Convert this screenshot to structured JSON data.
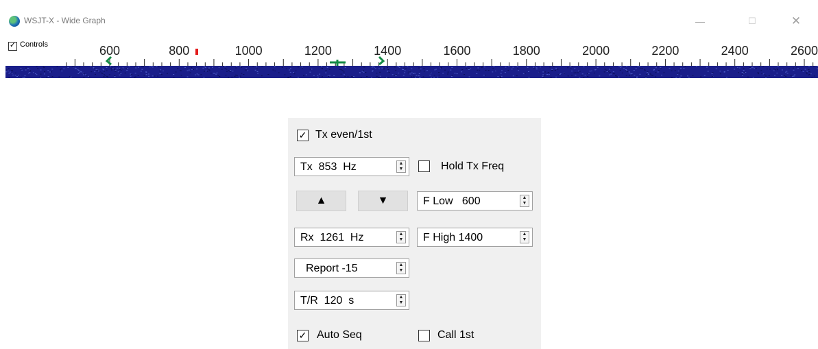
{
  "wide_graph": {
    "title": "WSJT-X - Wide Graph",
    "controls_label": "Controls",
    "controls_checked": true,
    "scale_labels": [
      "600",
      "800",
      "1000",
      "1200",
      "1400",
      "1600",
      "1800",
      "2000",
      "2200",
      "2400",
      "2600"
    ],
    "colors": {
      "ruler_marker_tx": "#e31b1b",
      "ruler_marker_green": "#148a45",
      "waterfall": "#1a1e8a"
    }
  },
  "panel": {
    "tx_even": {
      "label": "Tx even/1st",
      "checked": true
    },
    "tx_freq": {
      "value": "Tx  853  Hz"
    },
    "hold_tx": {
      "label": "Hold Tx Freq",
      "checked": false
    },
    "up_button": "▲",
    "down_button": "▼",
    "f_low": {
      "value": "F Low   600"
    },
    "rx_freq": {
      "value": "Rx  1261  Hz"
    },
    "f_high": {
      "value": "F High 1400"
    },
    "report": {
      "value": "Report -15"
    },
    "tr_period": {
      "value": "T/R  120  s"
    },
    "auto_seq": {
      "label": "Auto Seq",
      "checked": true
    },
    "call_1st": {
      "label": "Call 1st",
      "checked": false
    }
  }
}
